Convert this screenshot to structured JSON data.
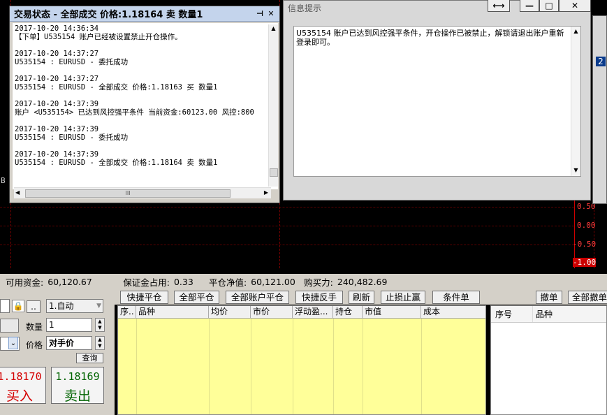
{
  "trade_window": {
    "title": "交易状态 - 全部成交 价格:1.18164 卖 数量1",
    "pin_icon": "pin-icon",
    "close_label": "✕",
    "log": [
      "2017-10-20 14:36:34",
      "【下单】U535154 账户已经被设置禁止开仓操作。",
      "",
      "2017-10-20 14:37:27",
      "U535154 : EURUSD - 委托成功",
      "",
      "2017-10-20 14:37:27",
      "U535154 : EURUSD - 全部成交 价格:1.18163 买 数量1",
      "",
      "2017-10-20 14:37:39",
      "账户 <U535154> 已达到风控强平条件 当前资金:60123.00 风控:800",
      "",
      "2017-10-20 14:37:39",
      "U535154 : EURUSD - 委托成功",
      "",
      "2017-10-20 14:37:39",
      "U535154 : EURUSD - 全部成交 价格:1.18164 卖 数量1"
    ],
    "hscroll_grip": "III"
  },
  "info_window": {
    "title": "信息提示",
    "message": "U535154 账户已达到风控强平条件，开仓操作已被禁止，解锁请退出账户重新登录即可。",
    "btn_resize": "⟷",
    "btn_min": "—",
    "btn_max": "□",
    "btn_close": "✕"
  },
  "side_window": {
    "chars": "2"
  },
  "chart": {
    "axis_labels": [
      "0.50",
      "0.00",
      "-0.50",
      "-1.00"
    ],
    "left_label": "B"
  },
  "account": {
    "available_label": "可用资金:",
    "available_value": "60,120.67",
    "margin_label": "保证金占用:",
    "margin_value": "0.33",
    "equity_label": "平仓净值:",
    "equity_value": "60,121.00",
    "buying_label": "购买力:",
    "buying_value": "240,482.69"
  },
  "order_panel": {
    "mode_value": "1.自动",
    "browse_label": "..",
    "qty_label": "数量",
    "qty_value": "1",
    "price_label": "价格",
    "price_value": "对手价",
    "query_label": "查询",
    "buy_price": "1.18170",
    "buy_label": "买入",
    "sell_price": "1.18169",
    "sell_label": "卖出",
    "buy_color": "#d40000",
    "sell_color": "#006400"
  },
  "toolbar": {
    "buttons": [
      "快捷平仓",
      "全部平仓",
      "全部账户平仓",
      "快捷反手",
      "刷新",
      "止损止赢",
      "条件单"
    ],
    "cancel_label": "撤单",
    "cancel_all_label": "全部撤单"
  },
  "positions": {
    "columns": [
      "序..",
      "品种",
      "均价",
      "市价",
      "浮动盈...",
      "持仓",
      "市值",
      "成本"
    ]
  },
  "orders": {
    "columns": [
      "序号",
      "品种"
    ]
  }
}
